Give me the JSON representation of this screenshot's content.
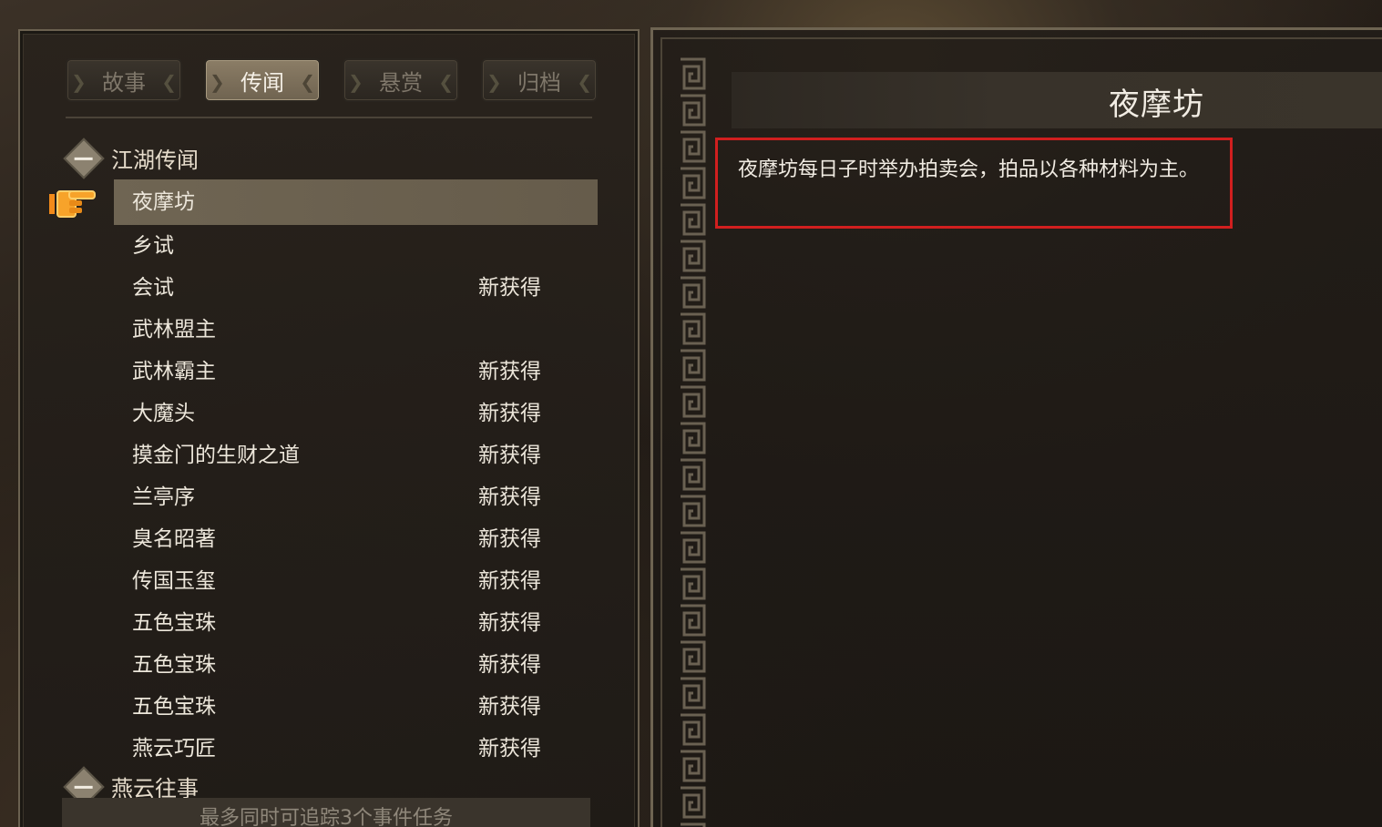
{
  "tabs": [
    {
      "label": "故事",
      "active": false
    },
    {
      "label": "传闻",
      "active": true
    },
    {
      "label": "悬赏",
      "active": false
    },
    {
      "label": "归档",
      "active": false
    }
  ],
  "groups": [
    {
      "label": "江湖传闻",
      "expanded": true
    },
    {
      "label": "燕云往事",
      "expanded": true
    }
  ],
  "rumors": [
    {
      "name": "夜摩坊",
      "badge": "",
      "selected": true
    },
    {
      "name": "乡试",
      "badge": ""
    },
    {
      "name": "会试",
      "badge": "新获得"
    },
    {
      "name": "武林盟主",
      "badge": ""
    },
    {
      "name": "武林霸主",
      "badge": "新获得"
    },
    {
      "name": "大魔头",
      "badge": "新获得"
    },
    {
      "name": "摸金门的生财之道",
      "badge": "新获得"
    },
    {
      "name": "兰亭序",
      "badge": "新获得"
    },
    {
      "name": "臭名昭著",
      "badge": "新获得"
    },
    {
      "name": "传国玉玺",
      "badge": "新获得"
    },
    {
      "name": "五色宝珠",
      "badge": "新获得"
    },
    {
      "name": "五色宝珠",
      "badge": "新获得"
    },
    {
      "name": "五色宝珠",
      "badge": "新获得"
    },
    {
      "name": "燕云巧匠",
      "badge": "新获得"
    }
  ],
  "footer": {
    "text": "最多同时可追踪3个事件任务"
  },
  "detail": {
    "title": "夜摩坊",
    "description": "夜摩坊每日子时举办拍卖会，拍品以各种材料为主。"
  },
  "colors": {
    "selected_row": "#6f6553",
    "highlight_box": "#d11f1f",
    "pointer": "#f28a1a"
  }
}
